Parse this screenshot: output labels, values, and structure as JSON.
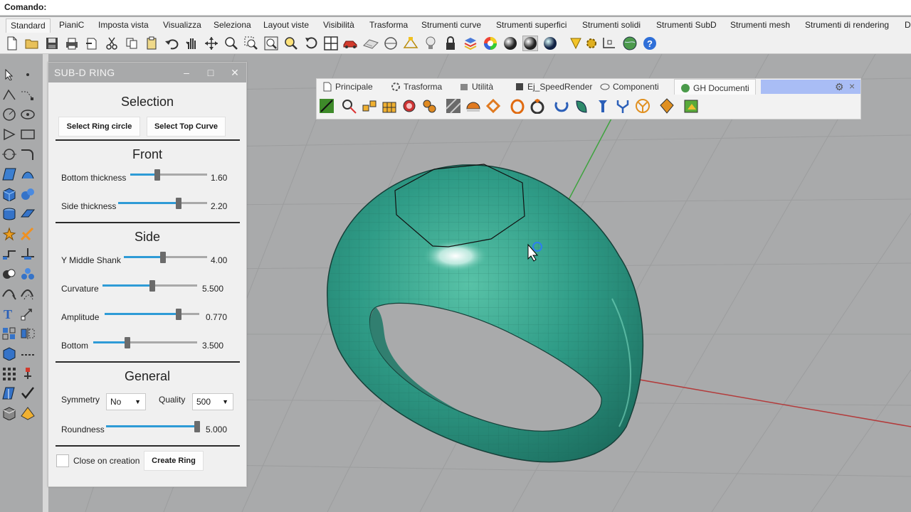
{
  "command": {
    "label": "Comando:",
    "value": ""
  },
  "main_tabs": [
    "Standard",
    "PianiC",
    "Imposta vista",
    "Visualizza",
    "Seleziona",
    "Layout viste",
    "Visibilità",
    "Trasforma",
    "Strumenti curve",
    "Strumenti superfici",
    "Strumenti solidi",
    "Strumenti SubD",
    "Strumenti mesh",
    "Strumenti di rendering",
    "D"
  ],
  "toolbar_icons": [
    "new-file-icon",
    "open-folder-icon",
    "save-icon",
    "print-icon",
    "import-icon",
    "cut-icon",
    "copy-icon",
    "paste-icon",
    "undo-icon",
    "pan-hand-icon",
    "move-view-icon",
    "zoom-icon",
    "zoom-window-icon",
    "zoom-extents-icon",
    "zoom-selected-icon",
    "rotate-view-icon",
    "four-viewports-icon",
    "car-named-view-icon",
    "construction-plane-icon",
    "osnap-icon",
    "point-icon",
    "bulb-icon",
    "lock-icon",
    "layer-icon",
    "color-wheel-icon",
    "shaded-sphere-icon",
    "rendered-sphere-icon",
    "material-sphere-icon",
    "gloss-sphere-icon",
    "highlight-icon",
    "settings-gear-icon",
    "dimension-icon",
    "globe-icon",
    "help-icon"
  ],
  "gh_bar": {
    "tabs": [
      "Principale",
      "Trasforma",
      "Utilità",
      "Ej_SpeedRender",
      "Componenti",
      "GH Documenti"
    ],
    "active_tab": "GH Documenti",
    "icons": [
      "gh-green-icon",
      "gh-ring-icon",
      "gh-cubes-icon",
      "gh-grid-icon",
      "gh-gem-icon",
      "gh-gear-pair-icon",
      "gh-texture-icon",
      "gh-dome-icon",
      "gh-chain-icon",
      "gh-ring-orange-icon",
      "gh-ring-stone-icon",
      "gh-arc-icon",
      "gh-leaf-icon",
      "gh-prong-icon",
      "gh-fork-icon",
      "gh-circle-y-icon",
      "gh-diamond-icon",
      "gh-folder-icon"
    ]
  },
  "panel": {
    "title": "SUB-D RING",
    "selection": {
      "heading": "Selection",
      "ring_button": "Select Ring circle",
      "curve_button": "Select Top Curve"
    },
    "front": {
      "heading": "Front",
      "sliders": [
        {
          "label": "Bottom thickness",
          "value": "1.60",
          "level": 0.35
        },
        {
          "label": "Side thickness",
          "value": "2.20",
          "level": 0.68
        }
      ]
    },
    "side": {
      "heading": "Side",
      "sliders": [
        {
          "label": "Y Middle Shank",
          "value": "4.00",
          "level": 0.47
        },
        {
          "label": "Curvature",
          "value": "5.500",
          "level": 0.53
        },
        {
          "label": "Amplitude",
          "value": "0.770",
          "level": 0.78
        },
        {
          "label": "Bottom",
          "value": "3.500",
          "level": 0.33
        }
      ]
    },
    "general": {
      "heading": "General",
      "symmetry_label": "Symmetry",
      "symmetry_value": "No",
      "quality_label": "Quality",
      "quality_value": "500",
      "roundness": {
        "label": "Roundness",
        "value": "5.000",
        "level": 1.0
      }
    },
    "close_label": "Close on creation",
    "create_button": "Create Ring"
  },
  "colors": {
    "ring": "#2e9b86",
    "slider_fill": "#2e9bd6",
    "viewport": "#a9aaab"
  }
}
